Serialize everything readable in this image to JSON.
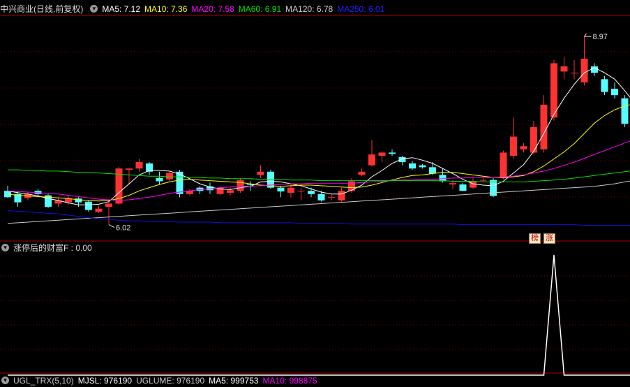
{
  "header": {
    "title": "中兴商业(日线,前复权)",
    "ma": [
      {
        "label": "MA5: 7.12",
        "color": "#ffffff"
      },
      {
        "label": "MA10: 7.36",
        "color": "#ffff00"
      },
      {
        "label": "MA20: 7.58",
        "color": "#ff00ff"
      },
      {
        "label": "MA60: 6.91",
        "color": "#00e000"
      },
      {
        "label": "MA120: 6.78",
        "color": "#d0d0d0"
      },
      {
        "label": "MA250: 6.01",
        "color": "#2020ff"
      }
    ]
  },
  "indicator": {
    "label": "涨停后的财富F : 0.00"
  },
  "bottom_bar": {
    "items": [
      {
        "label": "UGL_TRX(5,10)",
        "color": "#cccccc"
      },
      {
        "label": "MJSL: 976190",
        "color": "#ffffff"
      },
      {
        "label": "UGLUME: 976190",
        "color": "#cccccc"
      },
      {
        "label": "MA5: 999753",
        "color": "#ffffff"
      },
      {
        "label": "MA10: 998875",
        "color": "#ff00ff"
      }
    ]
  },
  "badges": [
    "榜",
    "涨"
  ],
  "colors": {
    "up": "#ff3232",
    "down": "#54ffff",
    "grid": "#7a0000",
    "separator": "#b00000"
  },
  "chart_data": {
    "type": "candlestick",
    "y_min": 5.95,
    "y_max": 9.3,
    "annotations": [
      {
        "label": "8.97",
        "index": 57,
        "kind": "high"
      },
      {
        "label": "6.02",
        "index": 10,
        "kind": "low"
      }
    ],
    "candles": [
      [
        6.55,
        6.45,
        6.63,
        6.44
      ],
      [
        6.5,
        6.37,
        6.55,
        6.3
      ],
      [
        6.44,
        6.5,
        6.53,
        6.4
      ],
      [
        6.55,
        6.5,
        6.58,
        6.45
      ],
      [
        6.48,
        6.3,
        6.5,
        6.28
      ],
      [
        6.35,
        6.4,
        6.45,
        6.3
      ],
      [
        6.37,
        6.43,
        6.47,
        6.33
      ],
      [
        6.43,
        6.37,
        6.45,
        6.3
      ],
      [
        6.38,
        6.25,
        6.4,
        6.22
      ],
      [
        6.22,
        6.27,
        6.32,
        6.2
      ],
      [
        6.3,
        6.35,
        6.4,
        6.02
      ],
      [
        6.35,
        6.9,
        6.93,
        6.33
      ],
      [
        6.88,
        6.9,
        6.9,
        6.65
      ],
      [
        6.9,
        7.0,
        7.05,
        6.85
      ],
      [
        6.98,
        6.85,
        7.0,
        6.8
      ],
      [
        6.75,
        6.7,
        6.85,
        6.65
      ],
      [
        6.73,
        6.83,
        6.85,
        6.7
      ],
      [
        6.85,
        6.5,
        6.88,
        6.45
      ],
      [
        6.5,
        6.55,
        6.58,
        6.48
      ],
      [
        6.6,
        6.55,
        6.62,
        6.5
      ],
      [
        6.62,
        6.56,
        6.68,
        6.5
      ],
      [
        6.5,
        6.6,
        6.62,
        6.48
      ],
      [
        6.52,
        6.56,
        6.6,
        6.48
      ],
      [
        6.55,
        6.72,
        6.75,
        6.52
      ],
      [
        6.65,
        6.64,
        6.7,
        6.55
      ],
      [
        6.8,
        6.85,
        6.95,
        6.75
      ],
      [
        6.85,
        6.6,
        6.88,
        6.58
      ],
      [
        6.6,
        6.54,
        6.62,
        6.45
      ],
      [
        6.52,
        6.6,
        6.65,
        6.45
      ],
      [
        6.55,
        6.55,
        6.6,
        6.4
      ],
      [
        6.55,
        6.5,
        6.6,
        6.45
      ],
      [
        6.5,
        6.4,
        6.55,
        6.38
      ],
      [
        6.45,
        6.45,
        6.5,
        6.4
      ],
      [
        6.4,
        6.55,
        6.6,
        6.38
      ],
      [
        6.55,
        6.7,
        6.75,
        6.52
      ],
      [
        6.8,
        6.85,
        6.9,
        6.78
      ],
      [
        6.95,
        7.12,
        7.35,
        6.93
      ],
      [
        7.1,
        7.15,
        7.17,
        7.0
      ],
      [
        7.15,
        7.13,
        7.2,
        7.1
      ],
      [
        7.08,
        7.0,
        7.1,
        6.95
      ],
      [
        6.98,
        6.9,
        7.02,
        6.88
      ],
      [
        6.95,
        6.92,
        6.97,
        6.9
      ],
      [
        6.92,
        6.82,
        7.0,
        6.8
      ],
      [
        6.8,
        6.7,
        6.9,
        6.68
      ],
      [
        6.65,
        6.67,
        6.72,
        6.58
      ],
      [
        6.65,
        6.55,
        6.68,
        6.55
      ],
      [
        6.6,
        6.7,
        6.75,
        6.58
      ],
      [
        6.72,
        6.72,
        6.75,
        6.7
      ],
      [
        6.72,
        6.47,
        6.75,
        6.45
      ],
      [
        6.75,
        7.15,
        7.18,
        6.73
      ],
      [
        7.1,
        7.4,
        7.7,
        7.05
      ],
      [
        7.2,
        7.25,
        7.3,
        7.15
      ],
      [
        7.15,
        7.55,
        7.65,
        7.12
      ],
      [
        7.2,
        7.9,
        8.05,
        7.15
      ],
      [
        7.7,
        8.55,
        8.6,
        7.65
      ],
      [
        8.42,
        8.5,
        8.65,
        8.3
      ],
      [
        8.4,
        8.4,
        8.6,
        8.3
      ],
      [
        8.25,
        8.62,
        8.97,
        8.2
      ],
      [
        8.5,
        8.4,
        8.55,
        8.35
      ],
      [
        8.3,
        8.1,
        8.35,
        8.05
      ],
      [
        8.15,
        8.05,
        8.25,
        8.0
      ],
      [
        8.0,
        7.6,
        8.05,
        7.55
      ],
      [
        7.6,
        7.6,
        7.65,
        7.4
      ],
      [
        7.45,
        7.68,
        7.7,
        7.45
      ],
      [
        7.6,
        7.8,
        7.85,
        7.55
      ]
    ],
    "ma_series": [
      {
        "name": "MA5",
        "color": "#ffffff",
        "values": [
          6.55,
          6.52,
          6.5,
          6.47,
          6.43,
          6.4,
          6.36,
          6.33,
          6.33,
          6.34,
          6.38,
          6.52,
          6.66,
          6.8,
          6.87,
          6.87,
          6.86,
          6.81,
          6.74,
          6.66,
          6.61,
          6.58,
          6.57,
          6.6,
          6.62,
          6.69,
          6.7,
          6.69,
          6.66,
          6.63,
          6.58,
          6.53,
          6.5,
          6.5,
          6.56,
          6.64,
          6.77,
          6.87,
          6.98,
          7.05,
          7.07,
          7.03,
          6.98,
          6.9,
          6.82,
          6.73,
          6.66,
          6.64,
          6.63,
          6.7,
          6.83,
          6.96,
          7.17,
          7.45,
          7.75,
          8.0,
          8.22,
          8.4,
          8.48,
          8.4,
          8.3,
          8.12,
          7.92,
          7.76,
          7.7
        ]
      },
      {
        "name": "MA10",
        "color": "#ffff00",
        "values": [
          6.5,
          6.48,
          6.47,
          6.46,
          6.45,
          6.44,
          6.43,
          6.41,
          6.4,
          6.39,
          6.4,
          6.43,
          6.48,
          6.55,
          6.6,
          6.65,
          6.69,
          6.72,
          6.73,
          6.72,
          6.71,
          6.7,
          6.69,
          6.68,
          6.66,
          6.64,
          6.63,
          6.62,
          6.63,
          6.64,
          6.64,
          6.63,
          6.62,
          6.61,
          6.6,
          6.61,
          6.64,
          6.68,
          6.72,
          6.76,
          6.79,
          6.8,
          6.82,
          6.84,
          6.84,
          6.82,
          6.8,
          6.78,
          6.76,
          6.76,
          6.77,
          6.79,
          6.85,
          6.94,
          7.05,
          7.16,
          7.29,
          7.45,
          7.61,
          7.73,
          7.82,
          7.88,
          7.92,
          7.95,
          7.98
        ]
      },
      {
        "name": "MA20",
        "color": "#ff00ff",
        "values": [
          6.55,
          6.54,
          6.53,
          6.52,
          6.51,
          6.5,
          6.48,
          6.46,
          6.44,
          6.42,
          6.41,
          6.4,
          6.41,
          6.43,
          6.45,
          6.48,
          6.51,
          6.53,
          6.55,
          6.57,
          6.58,
          6.6,
          6.61,
          6.62,
          6.62,
          6.63,
          6.64,
          6.65,
          6.66,
          6.66,
          6.67,
          6.67,
          6.67,
          6.67,
          6.67,
          6.68,
          6.69,
          6.7,
          6.71,
          6.72,
          6.72,
          6.73,
          6.73,
          6.74,
          6.75,
          6.75,
          6.76,
          6.76,
          6.76,
          6.77,
          6.78,
          6.8,
          6.83,
          6.86,
          6.9,
          6.95,
          7.0,
          7.06,
          7.12,
          7.18,
          7.24,
          7.3,
          7.36,
          7.42,
          7.48
        ]
      },
      {
        "name": "MA60",
        "color": "#00e000",
        "values": [
          6.88,
          6.88,
          6.87,
          6.87,
          6.86,
          6.86,
          6.85,
          6.84,
          6.84,
          6.83,
          6.82,
          6.81,
          6.8,
          6.79,
          6.78,
          6.78,
          6.77,
          6.77,
          6.76,
          6.76,
          6.75,
          6.75,
          6.74,
          6.74,
          6.74,
          6.73,
          6.73,
          6.73,
          6.72,
          6.72,
          6.72,
          6.71,
          6.71,
          6.71,
          6.71,
          6.71,
          6.71,
          6.71,
          6.71,
          6.71,
          6.71,
          6.71,
          6.71,
          6.71,
          6.7,
          6.7,
          6.7,
          6.69,
          6.69,
          6.69,
          6.69,
          6.69,
          6.7,
          6.71,
          6.72,
          6.73,
          6.75,
          6.77,
          6.79,
          6.81,
          6.83,
          6.85,
          6.87,
          6.89,
          6.91
        ]
      },
      {
        "name": "MA120",
        "color": "#c8c8c8",
        "values": [
          6.04,
          6.05,
          6.06,
          6.07,
          6.08,
          6.09,
          6.1,
          6.11,
          6.12,
          6.13,
          6.14,
          6.15,
          6.16,
          6.17,
          6.18,
          6.19,
          6.2,
          6.21,
          6.22,
          6.23,
          6.24,
          6.25,
          6.26,
          6.27,
          6.28,
          6.29,
          6.3,
          6.31,
          6.32,
          6.33,
          6.34,
          6.35,
          6.36,
          6.37,
          6.38,
          6.39,
          6.4,
          6.41,
          6.42,
          6.43,
          6.44,
          6.45,
          6.46,
          6.47,
          6.48,
          6.49,
          6.5,
          6.51,
          6.52,
          6.53,
          6.54,
          6.55,
          6.56,
          6.57,
          6.58,
          6.59,
          6.6,
          6.61,
          6.62,
          6.64,
          6.66,
          6.69,
          6.72,
          6.75,
          6.78
        ]
      },
      {
        "name": "MA250",
        "color": "#1010e0",
        "values": [
          6.24,
          6.23,
          6.22,
          6.21,
          6.2,
          6.19,
          6.17,
          6.15,
          6.13,
          6.11,
          6.1,
          6.09,
          6.08,
          6.08,
          6.07,
          6.07,
          6.07,
          6.06,
          6.06,
          6.06,
          6.06,
          6.05,
          6.05,
          6.05,
          6.05,
          6.05,
          6.05,
          6.05,
          6.05,
          6.04,
          6.04,
          6.04,
          6.04,
          6.04,
          6.03,
          6.03,
          6.03,
          6.03,
          6.03,
          6.03,
          6.03,
          6.03,
          6.03,
          6.03,
          6.03,
          6.02,
          6.02,
          6.02,
          6.02,
          6.02,
          6.02,
          6.02,
          6.02,
          6.02,
          6.02,
          6.02,
          6.02,
          6.01,
          6.01,
          6.01,
          6.01,
          6.01,
          6.01,
          6.01,
          6.01
        ]
      }
    ],
    "indicator_values": [
      0,
      0,
      0,
      0,
      0,
      0,
      0,
      0,
      0,
      0,
      0,
      0,
      0,
      0,
      0,
      0,
      0,
      0,
      0,
      0,
      0,
      0,
      0,
      0,
      0,
      0,
      0,
      0,
      0,
      0,
      0,
      0,
      0,
      0,
      0,
      0,
      0,
      0,
      0,
      0,
      0,
      0,
      0,
      0,
      0,
      0,
      0,
      0,
      0,
      0,
      0,
      0,
      0,
      0,
      1,
      0,
      0,
      0,
      0,
      0,
      0,
      0,
      0,
      0,
      0
    ],
    "indicator_range": [
      0,
      1
    ]
  }
}
